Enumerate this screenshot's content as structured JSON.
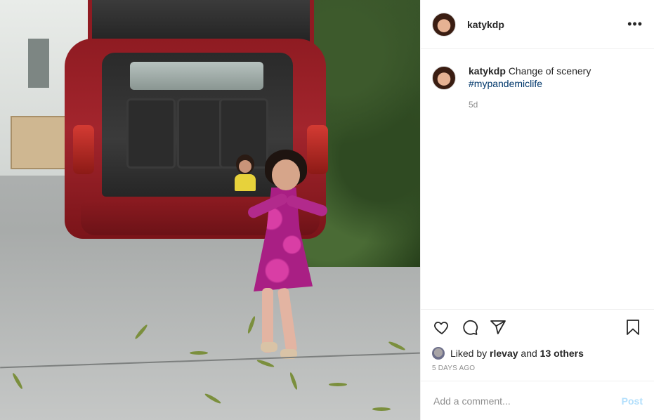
{
  "post": {
    "username": "katykdp",
    "more_icon": "more-horizontal-icon"
  },
  "caption": {
    "username": "katykdp",
    "text": "Change of scenery",
    "hashtag": "#mypandemiclife",
    "time": "5d"
  },
  "actions": {
    "icons": [
      "heart-icon",
      "comment-icon",
      "share-icon",
      "bookmark-icon"
    ]
  },
  "likes": {
    "prefix": "Liked by",
    "user": "rlevay",
    "joiner": "and",
    "others": "13 others"
  },
  "posted_ago": "5 DAYS AGO",
  "comment": {
    "placeholder": "Add a comment...",
    "post_label": "Post"
  },
  "colors": {
    "text": "#262626",
    "secondary": "#8e8e8e",
    "hashtag": "#00376b",
    "post_button_disabled": "#b2dffc",
    "divider": "#efefef"
  }
}
